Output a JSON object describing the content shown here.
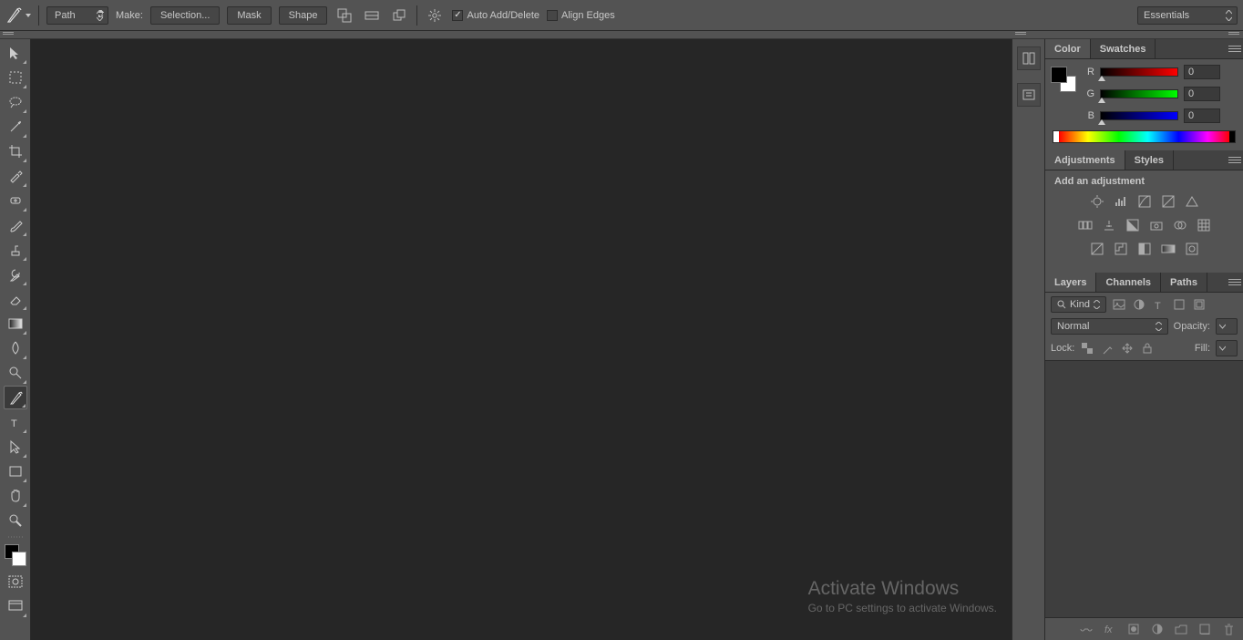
{
  "options_bar": {
    "mode_dropdown": "Path",
    "make_label": "Make:",
    "selection_btn": "Selection...",
    "mask_btn": "Mask",
    "shape_btn": "Shape",
    "auto_add_label": "Auto Add/Delete",
    "auto_add_checked": true,
    "align_edges_label": "Align Edges",
    "align_edges_checked": false,
    "workspace": "Essentials"
  },
  "color_panel": {
    "tab_color": "Color",
    "tab_swatches": "Swatches",
    "r_label": "R",
    "r_value": "0",
    "g_label": "G",
    "g_value": "0",
    "b_label": "B",
    "b_value": "0"
  },
  "adjustments_panel": {
    "tab_adjustments": "Adjustments",
    "tab_styles": "Styles",
    "heading": "Add an adjustment"
  },
  "layers_panel": {
    "tab_layers": "Layers",
    "tab_channels": "Channels",
    "tab_paths": "Paths",
    "kind_label": "Kind",
    "blend_mode": "Normal",
    "opacity_label": "Opacity:",
    "lock_label": "Lock:",
    "fill_label": "Fill:"
  },
  "watermark": {
    "title": "Activate Windows",
    "subtitle": "Go to PC settings to activate Windows."
  }
}
